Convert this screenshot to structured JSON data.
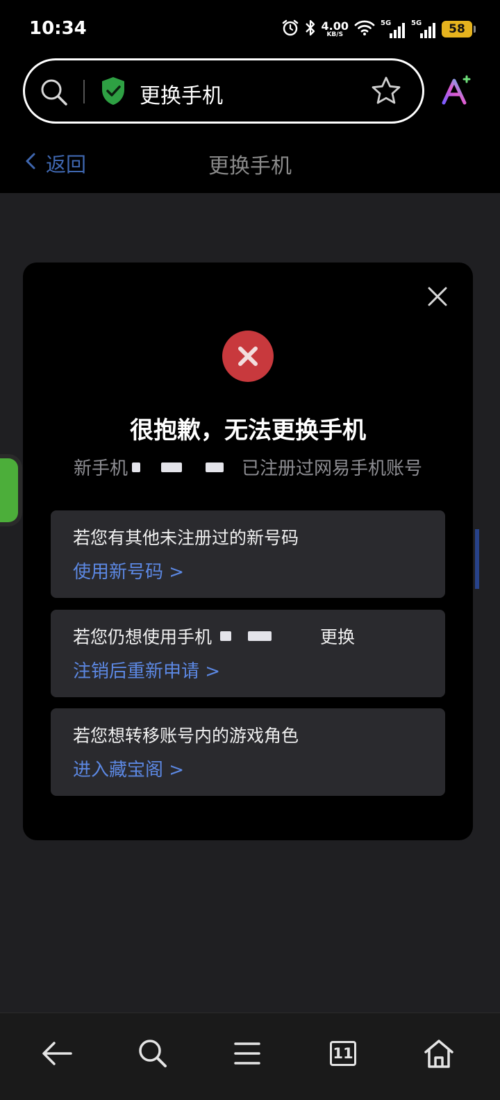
{
  "status_bar": {
    "time": "10:34",
    "net_speed_value": "4.00",
    "net_speed_unit": "KB/S",
    "sim1_label": "5G",
    "sim2_label": "5G",
    "battery": "58",
    "battery_color": "#e6b31e",
    "icons": [
      "alarm-icon",
      "bluetooth-icon",
      "wifi-icon",
      "signal-icon",
      "battery-icon"
    ]
  },
  "address_bar": {
    "title": "更换手机",
    "icons": [
      "search-icon",
      "shield-check-icon",
      "star-icon",
      "ai-assistant-icon"
    ]
  },
  "page_header": {
    "back_label": "返回",
    "title": "更换手机"
  },
  "modal": {
    "title": "很抱歉，无法更换手机",
    "subtitle_prefix": "新手机",
    "subtitle_suffix": "已注册过网易手机账号",
    "options": [
      {
        "text": "若您有其他未注册过的新号码",
        "link": "使用新号码 >"
      },
      {
        "text_prefix": "若您仍想使用手机",
        "text_suffix": "更换",
        "link": "注销后重新申请 >"
      },
      {
        "text": "若您想转移账号内的游戏角色",
        "link": "进入藏宝阁 >"
      }
    ],
    "error_color": "#c8393d",
    "link_color": "#5c88e3"
  },
  "bottom_nav": {
    "tab_count": "11",
    "icons": [
      "back-arrow-icon",
      "search-icon",
      "menu-icon",
      "tabs-icon",
      "home-icon"
    ]
  }
}
